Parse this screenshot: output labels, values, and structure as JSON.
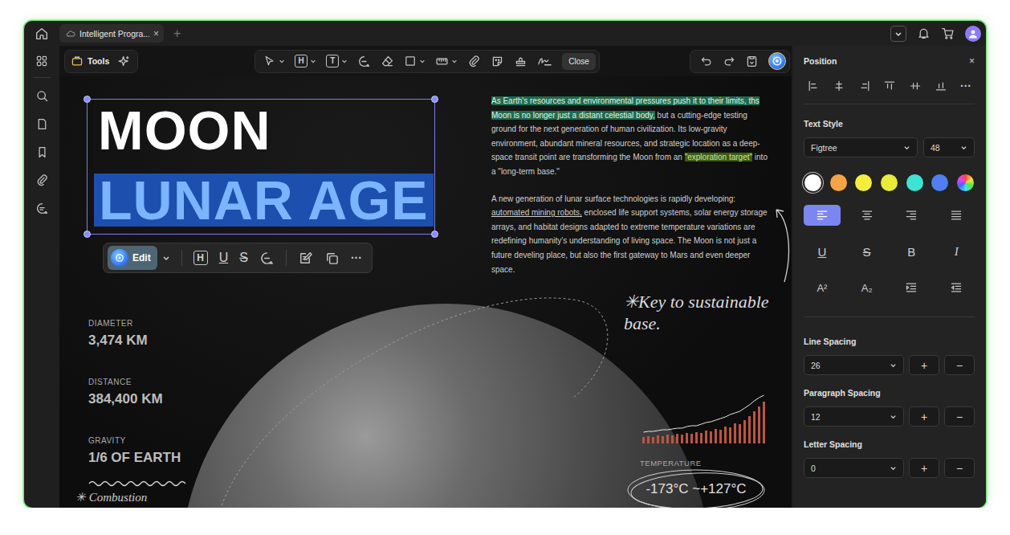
{
  "window": {
    "tab_title": "Intelligent Progra...",
    "tab_close": "×",
    "new_tab": "+"
  },
  "toolbar": {
    "tools_label": "Tools",
    "close_label": "Close",
    "heading_glyph": "H",
    "text_glyph": "T"
  },
  "document": {
    "title_lines": [
      {
        "text": "MOON",
        "selected": false
      },
      {
        "text": "LUNAR AGE",
        "selected": true
      }
    ],
    "edit_menu": {
      "edit_label": "Edit",
      "heading_glyph": "H",
      "underline_glyph": "U",
      "strike_glyph": "S",
      "more": "···"
    },
    "paragraphs": [
      [
        {
          "text": "As Earth's resources and environmental pressures push it to their limits, ths Moon is no longer just a distant celestial body,",
          "kind": "highlight"
        },
        {
          "text": " but a cutting-edge testing ground for the next generation of human civilization. Its low-gravity environment, abundant mineral resources, and strategic location as a deep-space transit point are transforming the Moon from an ",
          "kind": "plain"
        },
        {
          "text": "\"exploration target\"",
          "kind": "tag"
        },
        {
          "text": " into a \"long-term base.\"",
          "kind": "plain"
        }
      ],
      [
        {
          "text": "A new generation of lunar surface technologies is rapidly developing: ",
          "kind": "plain"
        },
        {
          "text": "automated mining robots,",
          "kind": "underline"
        },
        {
          "text": " enclosed life support systems, solar energy storage arrays, and habitat designs adapted to extreme temperature variations are redefining humanity's understanding of living space. The Moon is not just a future develing place, but also the first gateway to Mars and even deeper space.",
          "kind": "plain"
        }
      ]
    ],
    "note": "✳Key to sustainable base.",
    "stats": [
      {
        "label": "DIAMETER",
        "value": "3,474 KM"
      },
      {
        "label": "DISTANCE",
        "value": "384,400 KM"
      },
      {
        "label": "GRAVITY",
        "value": "1/6 OF EARTH"
      }
    ],
    "footnote": "✳ Combustion",
    "temperature": {
      "label": "TEMPERATURE",
      "value": "-173°C ~+127°C"
    },
    "chart": {
      "bars": [
        8,
        9,
        8,
        10,
        9,
        11,
        10,
        12,
        11,
        13,
        12,
        14,
        13,
        16,
        15,
        18,
        17,
        21,
        20,
        25,
        24,
        29,
        34,
        40,
        46,
        52
      ],
      "line": [
        14,
        15,
        15,
        16,
        17,
        17,
        18,
        19,
        19,
        21,
        22,
        22,
        24,
        26,
        27,
        29,
        31,
        33,
        36,
        38,
        40,
        44,
        48,
        53,
        57,
        60
      ]
    }
  },
  "panel": {
    "title": "Position",
    "close": "×",
    "more": "···",
    "text_style_label": "Text Style",
    "font": "Figtree",
    "size": "48",
    "swatches": [
      {
        "kind": "solid",
        "color": "#ffffff",
        "selected": true
      },
      {
        "kind": "solid",
        "color": "#f5a445",
        "selected": false
      },
      {
        "kind": "solid",
        "color": "#f3ee3c",
        "selected": false
      },
      {
        "kind": "solid",
        "color": "#e6ec39",
        "selected": false
      },
      {
        "kind": "solid",
        "color": "#3de3d5",
        "selected": false
      },
      {
        "kind": "solid",
        "color": "#4f7ff2",
        "selected": false
      },
      {
        "kind": "picker",
        "selected": false
      }
    ],
    "align_buttons": [
      {
        "kind": "left",
        "selected": true
      },
      {
        "kind": "center",
        "selected": false
      },
      {
        "kind": "right",
        "selected": false
      },
      {
        "kind": "justify",
        "selected": false
      }
    ],
    "format_buttons": [
      {
        "kind": "underline",
        "glyph": "U"
      },
      {
        "kind": "strike",
        "glyph": "S"
      },
      {
        "kind": "bold",
        "glyph": "B"
      },
      {
        "kind": "italic",
        "glyph": "I"
      }
    ],
    "script_buttons": [
      {
        "kind": "superscript",
        "glyph": "A²"
      },
      {
        "kind": "subscript",
        "glyph": "A₂"
      },
      {
        "kind": "indent",
        "glyph": ""
      },
      {
        "kind": "outdent",
        "glyph": ""
      }
    ],
    "spacing": [
      {
        "label": "Line Spacing",
        "value": "26"
      },
      {
        "label": "Paragraph Spacing",
        "value": "12"
      },
      {
        "label": "Letter Spacing",
        "value": "0"
      }
    ],
    "plus": "+",
    "minus": "−"
  }
}
